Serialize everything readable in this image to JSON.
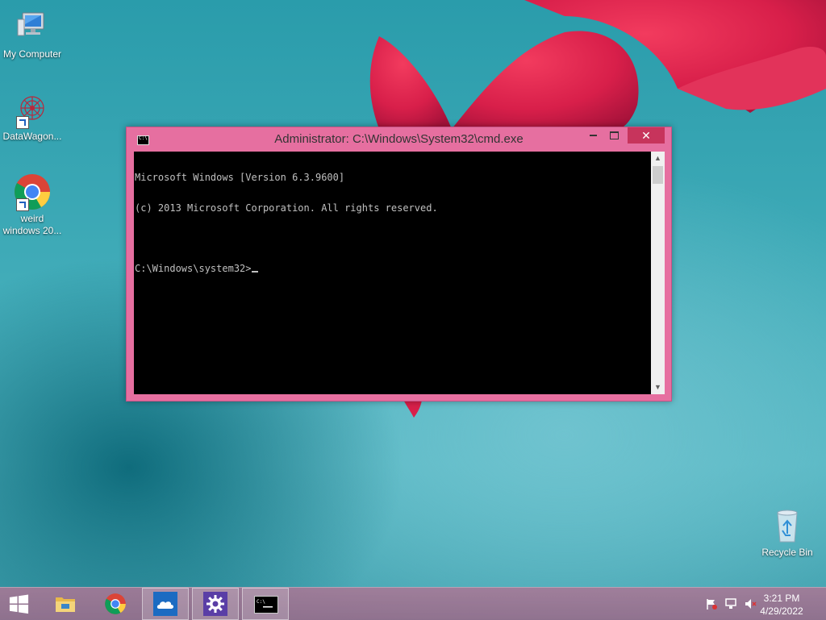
{
  "desktop": {
    "icons": [
      {
        "label": "My Computer",
        "icon": "computer-icon"
      },
      {
        "label": "DataWagon...",
        "icon": "datawagon-icon"
      },
      {
        "label_line1": "weird",
        "label_line2": "windows 20...",
        "icon": "chrome-icon"
      },
      {
        "label": "Recycle Bin",
        "icon": "recycle-bin-icon"
      }
    ]
  },
  "cmd_window": {
    "title": "Administrator: C:\\Windows\\System32\\cmd.exe",
    "lines": [
      "Microsoft Windows [Version 6.3.9600]",
      "(c) 2013 Microsoft Corporation. All rights reserved.",
      "",
      "C:\\Windows\\system32>"
    ],
    "close_label": "✕",
    "colors": {
      "frame": "#e66fa0",
      "close": "#c7345c"
    }
  },
  "taskbar": {
    "items": [
      {
        "name": "start",
        "icon": "windows-start-icon"
      },
      {
        "name": "file-explorer",
        "icon": "folder-icon"
      },
      {
        "name": "chrome",
        "icon": "chrome-icon"
      },
      {
        "name": "onedrive",
        "icon": "cloud-icon"
      },
      {
        "name": "settings",
        "icon": "gear-icon"
      },
      {
        "name": "cmd",
        "icon": "cmd-icon"
      }
    ],
    "tray": {
      "icons": [
        "flag-icon",
        "network-icon",
        "volume-muted-icon"
      ],
      "time": "3:21 PM",
      "date": "4/29/2022"
    }
  }
}
